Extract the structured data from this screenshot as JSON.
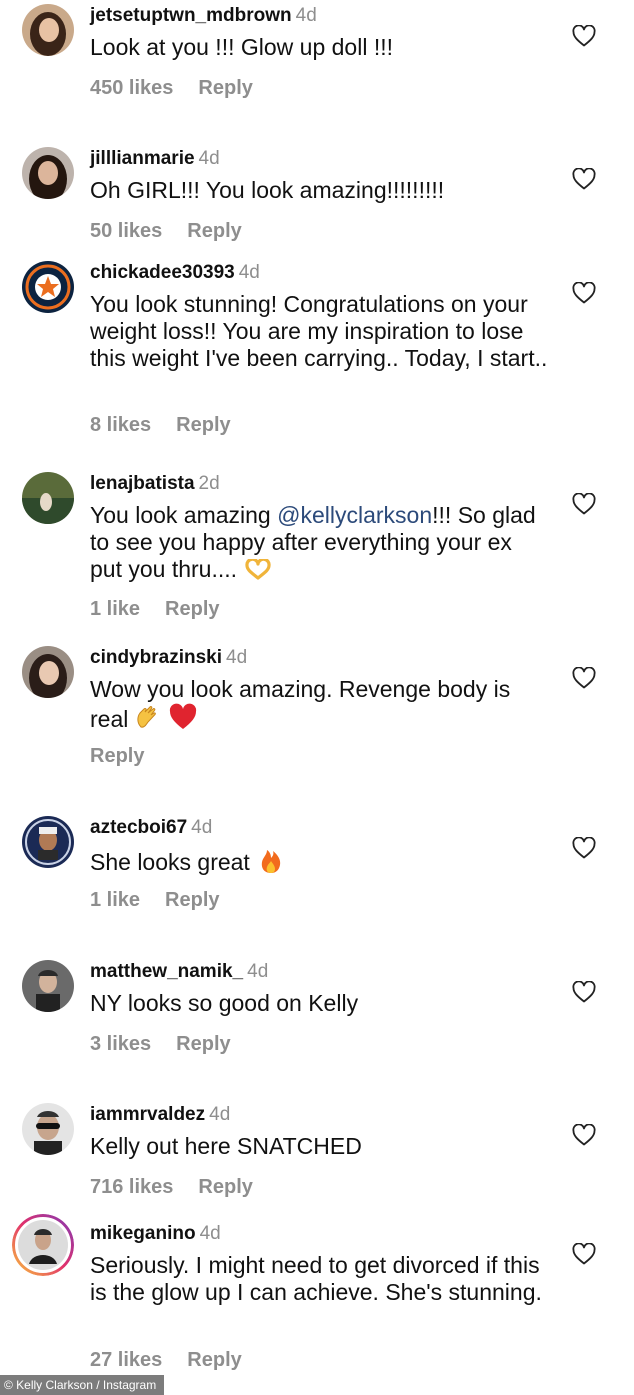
{
  "comments": [
    {
      "username": "jetsetuptwn_mdbrown",
      "time": "4d",
      "text": "Look at you !!! Glow up doll !!!",
      "likes": "450 likes",
      "reply": "Reply"
    },
    {
      "username": "jilllianmarie",
      "time": "4d",
      "text": "Oh GIRL!!! You look amazing!!!!!!!!!",
      "likes": "50 likes",
      "reply": "Reply"
    },
    {
      "username": "chickadee30393",
      "time": "4d",
      "text": "You look stunning! Congratulations on your weight loss!! You are my inspiration to lose this weight I've been carrying.. Today, I start..",
      "likes": "8 likes",
      "reply": "Reply"
    },
    {
      "username": "lenajbatista",
      "time": "2d",
      "text_before": "You look amazing ",
      "mention": "@kellyclarkson",
      "text_after": "!!! So glad to see you happy after everything your ex put you thru....",
      "emoji": "heart-hands-emoji",
      "likes": "1 like",
      "reply": "Reply"
    },
    {
      "username": "cindybrazinski",
      "time": "4d",
      "text": "Wow you look amazing. Revenge body is real",
      "emoji": [
        "clapping-hands-emoji",
        "red-heart-emoji"
      ],
      "likes": "",
      "reply": "Reply"
    },
    {
      "username": "aztecboi67",
      "time": "4d",
      "text": "She looks great",
      "emoji": "fire-emoji",
      "likes": "1 like",
      "reply": "Reply"
    },
    {
      "username": "matthew_namik_",
      "time": "4d",
      "text": "NY looks so good on Kelly",
      "likes": "3 likes",
      "reply": "Reply"
    },
    {
      "username": "iammrvaldez",
      "time": "4d",
      "text": "Kelly out here SNATCHED",
      "likes": "716 likes",
      "reply": "Reply"
    },
    {
      "username": "mikeganino",
      "time": "4d",
      "text": "Seriously. I might need to get divorced if this is the glow up I can achieve. She's stunning.",
      "likes": "27 likes",
      "reply": "Reply"
    }
  ],
  "credit": "© Kelly Clarkson / Instagram",
  "colors": {
    "text": "#111111",
    "muted": "#8e8e8e",
    "mention": "#2c4a7a"
  }
}
